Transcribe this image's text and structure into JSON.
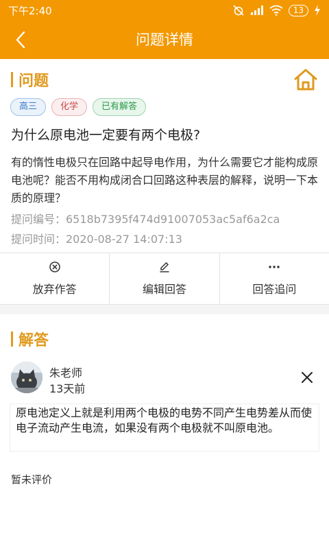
{
  "status": {
    "time": "下午2:40",
    "battery": "13"
  },
  "appbar": {
    "title": "问题详情",
    "back_icon": "chevron-left-icon"
  },
  "question": {
    "section_label": "问题",
    "tags": [
      "高三",
      "化学",
      "已有解答"
    ],
    "title": "为什么原电池一定要有两个电极?",
    "body": "有的惰性电极只在回路中起导电作用，为什么需要它才能构成原电池呢？能否不用构成闭合口回路这种表层的解释，说明一下本质的原理？",
    "id_line": "提问编号：6518b7395f474d91007053ac5af6a2ca",
    "time_line": "提问时间：2020-08-27 14:07:13"
  },
  "actions": [
    {
      "label": "放弃作答",
      "icon": "circle-x-icon"
    },
    {
      "label": "编辑回答",
      "icon": "pencil-icon"
    },
    {
      "label": "回答追问",
      "icon": "more-dots-icon"
    }
  ],
  "answer": {
    "section_label": "解答",
    "teacher": "朱老师",
    "time_ago": "13天前",
    "content": "原电池定义上就是利用两个电极的电势不同产生电势差从而使电子流动产生电流，如果没有两个电极就不叫原电池。",
    "review_status": "暂未评价"
  },
  "colors": {
    "primary": "#f39800",
    "accent": "#e09a1e"
  }
}
